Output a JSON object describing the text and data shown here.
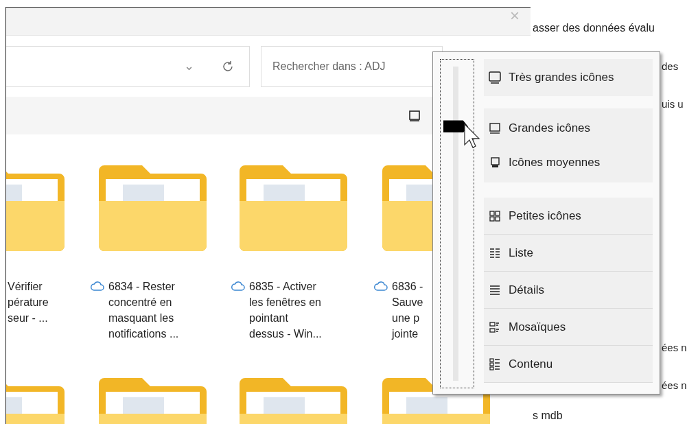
{
  "explorer": {
    "close": "×",
    "address": {
      "chevron": "⌄"
    },
    "search": {
      "placeholder": "Rechercher dans : ADJ"
    },
    "folders": [
      {
        "cloud": false,
        "lines": [
          "Vérifier",
          "pérature",
          "seur - ..."
        ]
      },
      {
        "cloud": true,
        "lines": [
          "6834 - Rester",
          "concentré en",
          "masquant les",
          "notifications ..."
        ]
      },
      {
        "cloud": true,
        "lines": [
          "6835 - Activer",
          "les fenêtres en",
          "pointant",
          "dessus - Win..."
        ]
      },
      {
        "cloud": true,
        "lines": [
          "6836 -",
          "Sauve",
          "une p",
          "jointe"
        ]
      }
    ]
  },
  "document_lines": [
    {
      "text": "asser des données évalu",
      "kind": "line"
    },
    {
      "text": "des",
      "kind": "line"
    },
    {
      "text": "uis u",
      "kind": "line"
    },
    {
      "text": "ées n",
      "kind": "line"
    },
    {
      "text": "ées n",
      "kind": "line"
    },
    {
      "text": "s mdb",
      "kind": "line"
    }
  ],
  "view_menu": {
    "slider": {
      "level": 0.81
    },
    "items": [
      {
        "label": "Très grandes icônes",
        "kind": "monitorlarge"
      },
      {
        "label": "Grandes icônes",
        "kind": "monitor"
      },
      {
        "label": "Icônes moyennes",
        "kind": "monitorsmall"
      },
      {
        "label": "Petites icônes",
        "kind": "grid"
      },
      {
        "label": "Liste",
        "kind": "list"
      },
      {
        "label": "Détails",
        "kind": "details"
      },
      {
        "label": "Mosaïques",
        "kind": "tiles"
      },
      {
        "label": "Contenu",
        "kind": "content"
      }
    ]
  }
}
